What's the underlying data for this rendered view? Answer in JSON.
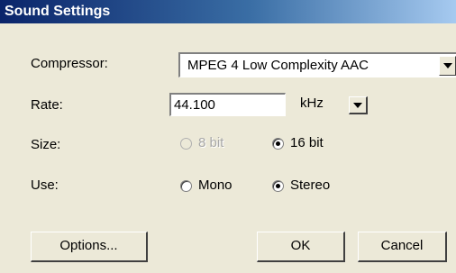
{
  "window": {
    "title": "Sound Settings"
  },
  "compressor": {
    "label": "Compressor:",
    "value": "MPEG 4 Low Complexity AAC"
  },
  "rate": {
    "label": "Rate:",
    "value": "44.100",
    "unit": "kHz"
  },
  "size": {
    "label": "Size:",
    "options": [
      {
        "label": "8 bit",
        "selected": false,
        "enabled": false
      },
      {
        "label": "16 bit",
        "selected": true,
        "enabled": true
      }
    ]
  },
  "use": {
    "label": "Use:",
    "options": [
      {
        "label": "Mono",
        "selected": false,
        "enabled": true
      },
      {
        "label": "Stereo",
        "selected": true,
        "enabled": true
      }
    ]
  },
  "buttons": {
    "options": "Options...",
    "ok": "OK",
    "cancel": "Cancel"
  },
  "colors": {
    "title_start": "#0a246a",
    "title_end": "#a6caf0",
    "face": "#ece9d8"
  },
  "icons": {
    "dropdown": "chevron-down-icon"
  }
}
